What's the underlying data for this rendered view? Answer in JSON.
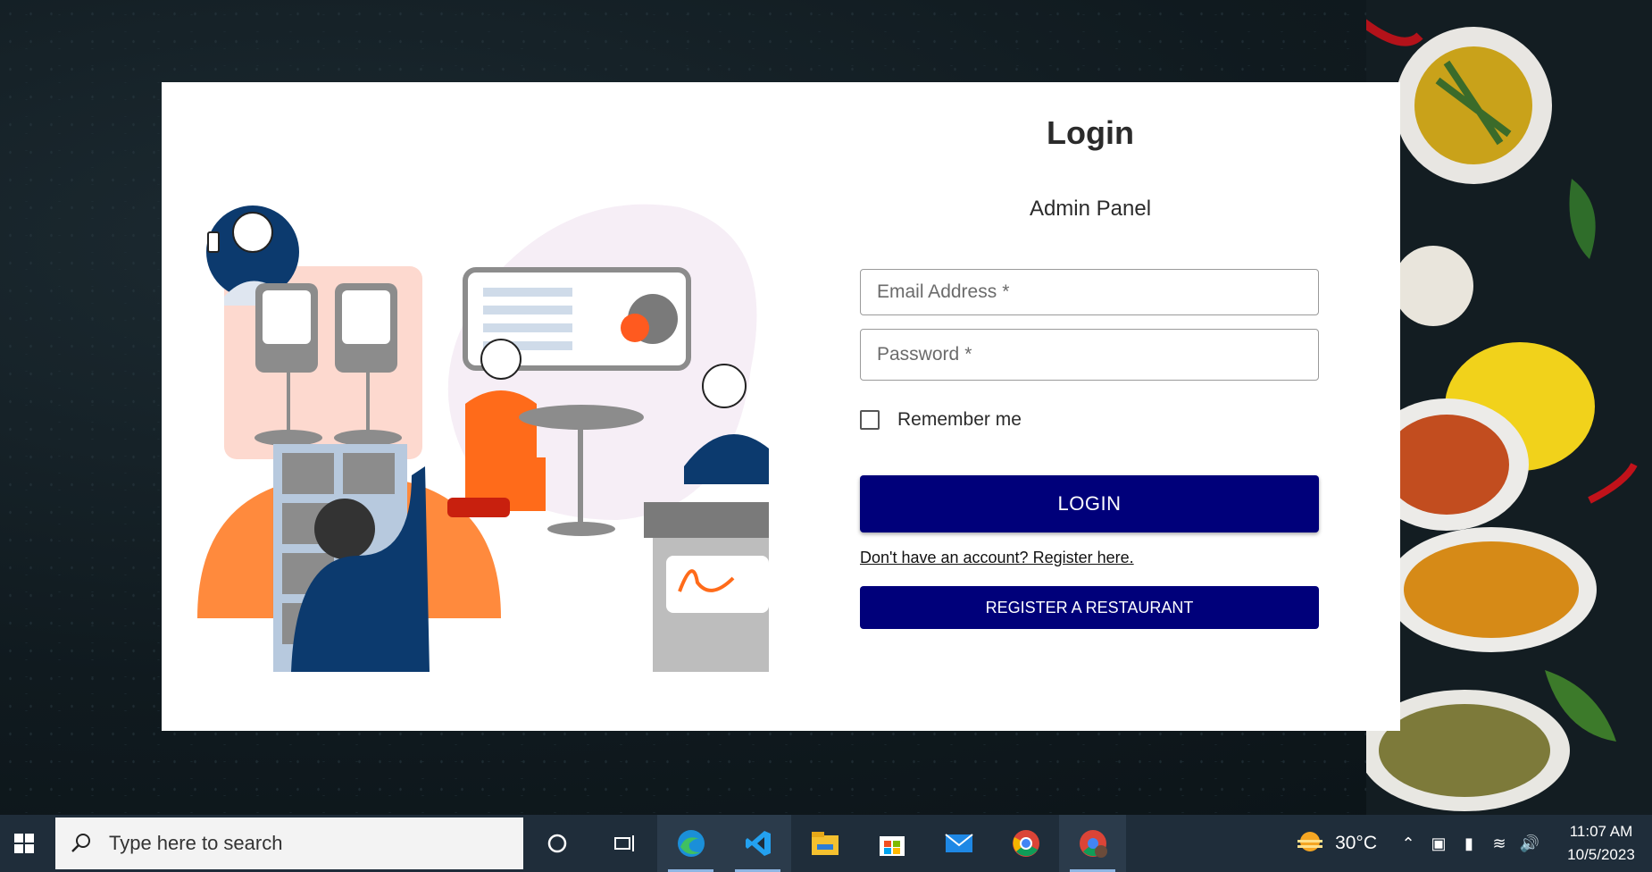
{
  "login": {
    "title": "Login",
    "subtitle": "Admin Panel",
    "email_placeholder": "Email Address",
    "password_placeholder": "Password",
    "required_mark": "*",
    "remember_label": "Remember me",
    "login_button": "LOGIN",
    "register_link": "Don't have an account? Register here.",
    "register_button": "REGISTER A RESTAURANT"
  },
  "taskbar": {
    "search_placeholder": "Type here to search",
    "temperature": "30°C",
    "time": "11:07 AM",
    "date": "10/5/2023",
    "apps": [
      "cortana-icon",
      "task-view-icon",
      "edge-icon",
      "vscode-icon",
      "file-explorer-icon",
      "store-icon",
      "mail-icon",
      "chrome-icon",
      "chrome-profile-icon"
    ]
  },
  "colors": {
    "primary_button": "#00007a",
    "accent_orange": "#ff6b1a",
    "illustration_navy": "#0c3a6e"
  }
}
